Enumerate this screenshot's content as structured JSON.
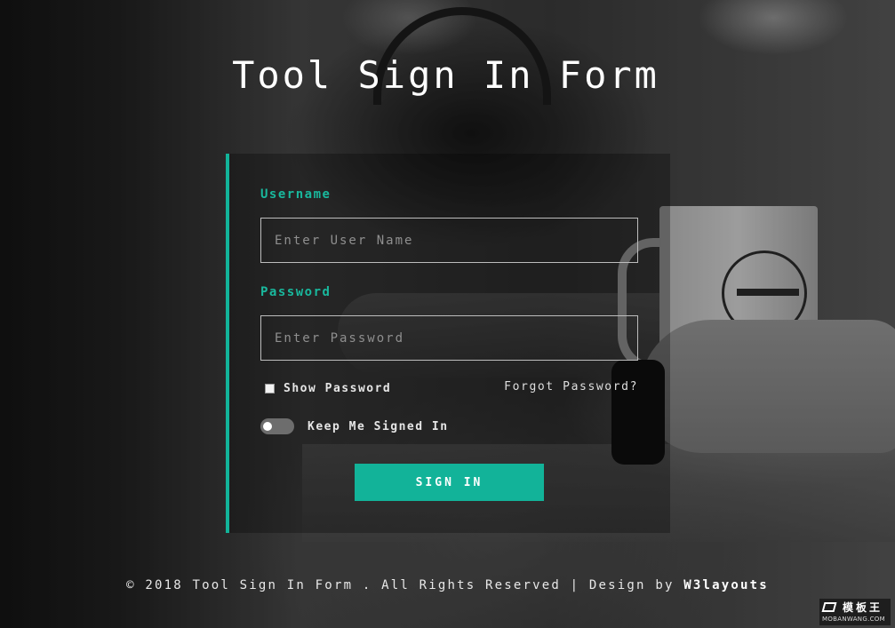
{
  "page": {
    "title": "Tool Sign In Form"
  },
  "form": {
    "username_label": "Username",
    "username_placeholder": "Enter User Name",
    "password_label": "Password",
    "password_placeholder": "Enter Password",
    "show_password_label": "Show Password",
    "show_password_checked": false,
    "forgot_password_label": "Forgot Password?",
    "keep_signed_in_label": "Keep Me Signed In",
    "keep_signed_in_on": false,
    "signin_label": "SIGN IN"
  },
  "footer": {
    "copyright": "© 2018 Tool Sign In Form . All Rights Reserved | Design by",
    "brand": "W3layouts"
  },
  "watermark": {
    "name": "模板王",
    "url": "MOBANWANG.COM"
  },
  "colors": {
    "accent": "#12b399",
    "label": "#19b89d"
  }
}
